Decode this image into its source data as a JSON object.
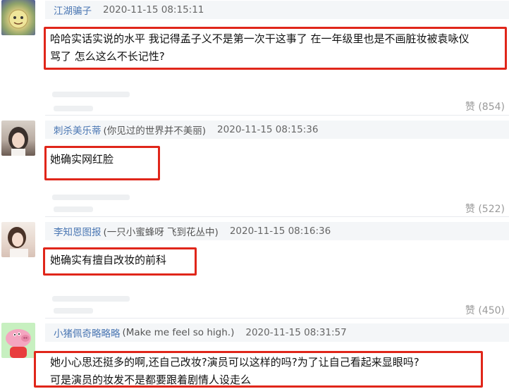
{
  "comments": [
    {
      "user": "江湖骗子",
      "signature": "",
      "time": "2020-11-15 08:15:11",
      "lines": [
        "哈哈实话实说的水平 我记得孟子义不是第一次干这事了 在一年级里也是不画脏妆被袁咏仪",
        "骂了 怎么这么不长记性?"
      ],
      "like_label": "赞 (854)"
    },
    {
      "user": "刺杀美乐蒂",
      "signature": "(你见过的世界并不美丽)",
      "time": "2020-11-15 08:15:36",
      "lines": [
        "她确实网红脸"
      ],
      "like_label": "赞 (522)"
    },
    {
      "user": "李知恩图报",
      "signature": "(一只小蜜蜂呀 飞到花丛中)",
      "time": "2020-11-15 08:16:36",
      "lines": [
        "她确实有擅自改妆的前科"
      ],
      "like_label": "赞 (450)"
    },
    {
      "user": "小猪佩奇略略略",
      "signature": "(Make me feel so high.)",
      "time": "2020-11-15 08:31:57",
      "lines": [
        "她小心思还挺多的啊,还自己改妆?演员可以这样的吗?为了让自己看起来显眼吗?",
        "可是演员的妆发不是都要跟着剧情人设走么"
      ],
      "like_label": ""
    }
  ],
  "colors": {
    "highlight": "#e0261a",
    "username": "#4b77b3",
    "header_bg": "#f4f6f8"
  },
  "icons": [
    "avatar-sun-face",
    "avatar-woman-photo",
    "avatar-woman-photo",
    "avatar-peppa-pig"
  ]
}
